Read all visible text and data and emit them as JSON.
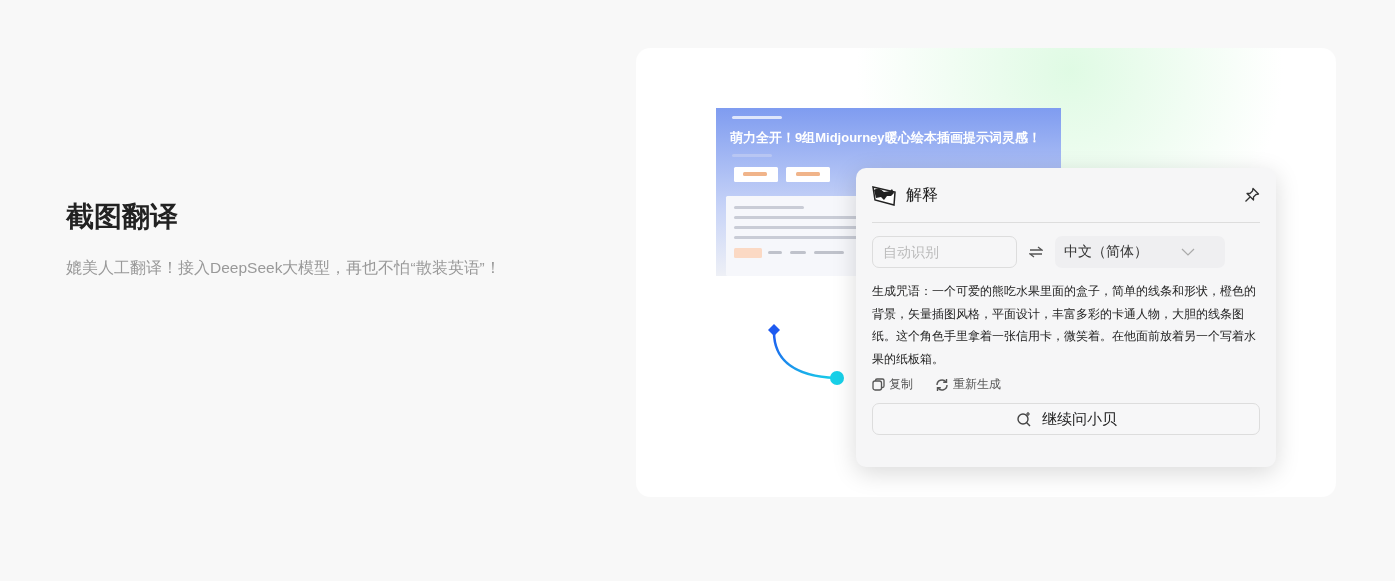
{
  "intro": {
    "title": "截图翻译",
    "subtitle": "媲美人工翻译！接入DeepSeek大模型，再也不怕“散装英语”！"
  },
  "screenshot": {
    "kind": "picture",
    "title": "萌力全开！9组Midjourney暖心绘本插画提示词灵感！"
  },
  "popup": {
    "title": "解释",
    "source_field": {
      "placeholder": "自动识别"
    },
    "target_language": {
      "value": "中文（简体）"
    },
    "result": "生成咒语：一个可爱的熊吃水果里面的盒子，简单的线条和形状，橙色的背景，矢量插图风格，平面设计，丰富多彩的卡通人物，大胆的线条图纸。这个角色手里拿着一张信用卡，微笑着。在他面前放着另一个写着水果的纸板箱。",
    "actions": [
      {
        "kind": "copy",
        "label": "复制"
      },
      {
        "kind": "regenerate",
        "label": "重新生成"
      }
    ],
    "ask_button": {
      "label": "继续问小贝"
    }
  }
}
